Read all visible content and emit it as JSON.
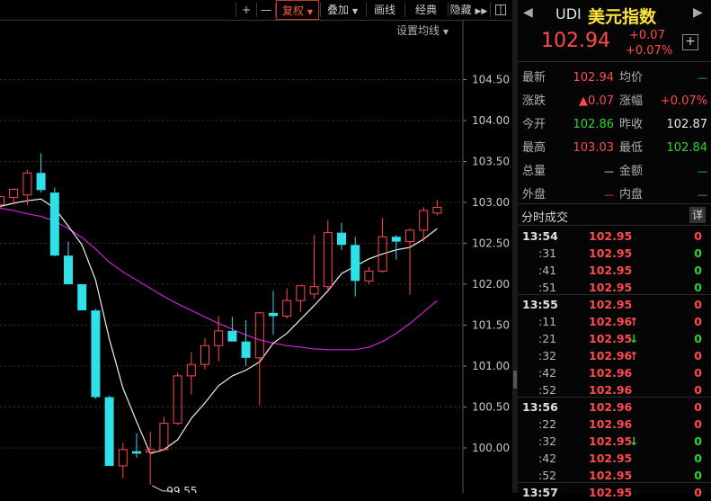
{
  "toolbar": {
    "plus": "+",
    "minus": "—",
    "fq": "复权",
    "overlay": "叠加",
    "draw": "画线",
    "classic": "经典",
    "hide": "隐藏"
  },
  "ma_setting": "设置均线",
  "chart_data": {
    "type": "candlestick",
    "ylim": [
      99.45,
      105.0
    ],
    "y_ticks": [
      "104.50",
      "104.00",
      "103.50",
      "103.00",
      "102.50",
      "102.00",
      "101.50",
      "101.00",
      "100.50",
      "100.00"
    ],
    "candles": [
      {
        "o": 102.97,
        "h": 103.07,
        "l": 102.92,
        "c": 103.07
      },
      {
        "o": 103.06,
        "h": 103.17,
        "l": 102.97,
        "c": 103.16
      },
      {
        "o": 103.09,
        "h": 103.4,
        "l": 102.97,
        "c": 103.36
      },
      {
        "o": 103.36,
        "h": 103.6,
        "l": 103.12,
        "c": 103.15
      },
      {
        "o": 103.12,
        "h": 103.18,
        "l": 102.34,
        "c": 102.35
      },
      {
        "o": 102.35,
        "h": 102.52,
        "l": 102.0,
        "c": 102.0
      },
      {
        "o": 102.0,
        "h": 101.99,
        "l": 101.68,
        "c": 101.68
      },
      {
        "o": 101.68,
        "h": 101.7,
        "l": 100.6,
        "c": 100.62
      },
      {
        "o": 100.62,
        "h": 100.64,
        "l": 99.78,
        "c": 99.78
      },
      {
        "o": 99.78,
        "h": 100.06,
        "l": 99.63,
        "c": 99.98
      },
      {
        "o": 99.96,
        "h": 100.18,
        "l": 99.88,
        "c": 99.93
      },
      {
        "o": 99.95,
        "h": 100.2,
        "l": 99.55,
        "c": 99.98
      },
      {
        "o": 99.98,
        "h": 100.38,
        "l": 99.96,
        "c": 100.3
      },
      {
        "o": 100.3,
        "h": 100.92,
        "l": 100.28,
        "c": 100.88
      },
      {
        "o": 100.88,
        "h": 101.17,
        "l": 100.65,
        "c": 101.02
      },
      {
        "o": 101.02,
        "h": 101.34,
        "l": 100.96,
        "c": 101.25
      },
      {
        "o": 101.25,
        "h": 101.61,
        "l": 101.06,
        "c": 101.43
      },
      {
        "o": 101.43,
        "h": 101.6,
        "l": 101.3,
        "c": 101.3
      },
      {
        "o": 101.3,
        "h": 101.56,
        "l": 101.0,
        "c": 101.1
      },
      {
        "o": 101.1,
        "h": 101.66,
        "l": 100.52,
        "c": 101.65
      },
      {
        "o": 101.65,
        "h": 101.92,
        "l": 101.38,
        "c": 101.61
      },
      {
        "o": 101.61,
        "h": 101.95,
        "l": 101.58,
        "c": 101.8
      },
      {
        "o": 101.8,
        "h": 101.98,
        "l": 101.66,
        "c": 101.98
      },
      {
        "o": 101.88,
        "h": 102.6,
        "l": 101.82,
        "c": 101.97
      },
      {
        "o": 101.97,
        "h": 102.78,
        "l": 101.9,
        "c": 102.63
      },
      {
        "o": 102.63,
        "h": 102.75,
        "l": 102.42,
        "c": 102.48
      },
      {
        "o": 102.48,
        "h": 102.58,
        "l": 101.85,
        "c": 102.04
      },
      {
        "o": 102.04,
        "h": 102.21,
        "l": 102.0,
        "c": 102.16
      },
      {
        "o": 102.16,
        "h": 102.81,
        "l": 102.14,
        "c": 102.58
      },
      {
        "o": 102.58,
        "h": 102.6,
        "l": 102.3,
        "c": 102.52
      },
      {
        "o": 102.52,
        "h": 102.68,
        "l": 101.87,
        "c": 102.66
      },
      {
        "o": 102.66,
        "h": 102.94,
        "l": 102.52,
        "c": 102.9
      },
      {
        "o": 102.87,
        "h": 103.03,
        "l": 102.84,
        "c": 102.94
      }
    ],
    "ma_short": [
      102.95,
      102.99,
      103.02,
      103.04,
      102.93,
      102.71,
      102.48,
      102.05,
      101.33,
      100.73,
      100.32,
      99.93,
      99.98,
      100.1,
      100.36,
      100.55,
      100.76,
      100.88,
      100.95,
      101.05,
      101.28,
      101.4,
      101.57,
      101.74,
      101.92,
      102.13,
      102.22,
      102.31,
      102.37,
      102.42,
      102.45,
      102.55,
      102.68
    ],
    "ma_long": [
      102.93,
      102.9,
      102.86,
      102.83,
      102.77,
      102.68,
      102.57,
      102.43,
      102.27,
      102.15,
      102.05,
      101.95,
      101.85,
      101.76,
      101.68,
      101.6,
      101.52,
      101.45,
      101.38,
      101.32,
      101.28,
      101.25,
      101.23,
      101.21,
      101.2,
      101.2,
      101.2,
      101.23,
      101.3,
      101.4,
      101.52,
      101.66,
      101.8
    ],
    "low_annotation": "99.55"
  },
  "quote": {
    "code": "UDI",
    "name": "美元指数",
    "price": "102.94",
    "change": "+0.07",
    "change_pct": "+0.07%",
    "add_btn": "+",
    "stats": [
      {
        "l1": "最新",
        "v1": "102.94",
        "c1": "red",
        "l2": "均价",
        "v2": "—",
        "c2": "green"
      },
      {
        "l1": "涨跌",
        "v1": "▲0.07",
        "c1": "red",
        "l2": "涨幅",
        "v2": "+0.07%",
        "c2": "red"
      },
      {
        "l1": "今开",
        "v1": "102.86",
        "c1": "green",
        "l2": "昨收",
        "v2": "102.87",
        "c2": "white"
      },
      {
        "l1": "最高",
        "v1": "103.03",
        "c1": "red",
        "l2": "最低",
        "v2": "102.84",
        "c2": "green"
      },
      {
        "l1": "总量",
        "v1": "—",
        "c1": "white",
        "l2": "金额",
        "v2": "—",
        "c2": "cyan"
      },
      {
        "l1": "外盘",
        "v1": "—",
        "c1": "red",
        "l2": "内盘",
        "v2": "—",
        "c2": "green"
      }
    ],
    "ticks_title": "分时成交",
    "ticks_detail": "详",
    "ticks": [
      {
        "t": "13:54",
        "p": "102.95",
        "a": "",
        "v": "0",
        "vc": "red",
        "head": true
      },
      {
        "t": ":31",
        "p": "102.95",
        "a": "",
        "v": "0",
        "vc": "green",
        "head": false
      },
      {
        "t": ":41",
        "p": "102.95",
        "a": "",
        "v": "0",
        "vc": "green",
        "head": false
      },
      {
        "t": ":51",
        "p": "102.95",
        "a": "",
        "v": "0",
        "vc": "green",
        "head": false
      },
      {
        "t": "13:55",
        "p": "102.95",
        "a": "",
        "v": "0",
        "vc": "red",
        "head": true
      },
      {
        "t": ":11",
        "p": "102.96",
        "a": "↑",
        "v": "0",
        "vc": "red",
        "head": false
      },
      {
        "t": ":21",
        "p": "102.95",
        "a": "↓",
        "v": "0",
        "vc": "green",
        "head": false
      },
      {
        "t": ":32",
        "p": "102.96",
        "a": "↑",
        "v": "0",
        "vc": "red",
        "head": false
      },
      {
        "t": ":42",
        "p": "102.96",
        "a": "",
        "v": "0",
        "vc": "red",
        "head": false
      },
      {
        "t": ":52",
        "p": "102.96",
        "a": "",
        "v": "0",
        "vc": "red",
        "head": false
      },
      {
        "t": "13:56",
        "p": "102.96",
        "a": "",
        "v": "0",
        "vc": "red",
        "head": true
      },
      {
        "t": ":22",
        "p": "102.96",
        "a": "",
        "v": "0",
        "vc": "red",
        "head": false
      },
      {
        "t": ":32",
        "p": "102.95",
        "a": "↓",
        "v": "0",
        "vc": "green",
        "head": false
      },
      {
        "t": ":42",
        "p": "102.95",
        "a": "",
        "v": "0",
        "vc": "green",
        "head": false
      },
      {
        "t": ":52",
        "p": "102.95",
        "a": "",
        "v": "0",
        "vc": "green",
        "head": false
      },
      {
        "t": "13:57",
        "p": "102.95",
        "a": "",
        "v": "0",
        "vc": "red",
        "head": true
      }
    ]
  },
  "colors": {
    "up": "#ff4b4b",
    "down": "#2fe0e8",
    "ma_short": "#f0f0f0",
    "ma_long": "#d020d0",
    "grid": "#5a1e1e",
    "green": "#2fd42f",
    "cyan": "#2fd0e0"
  }
}
